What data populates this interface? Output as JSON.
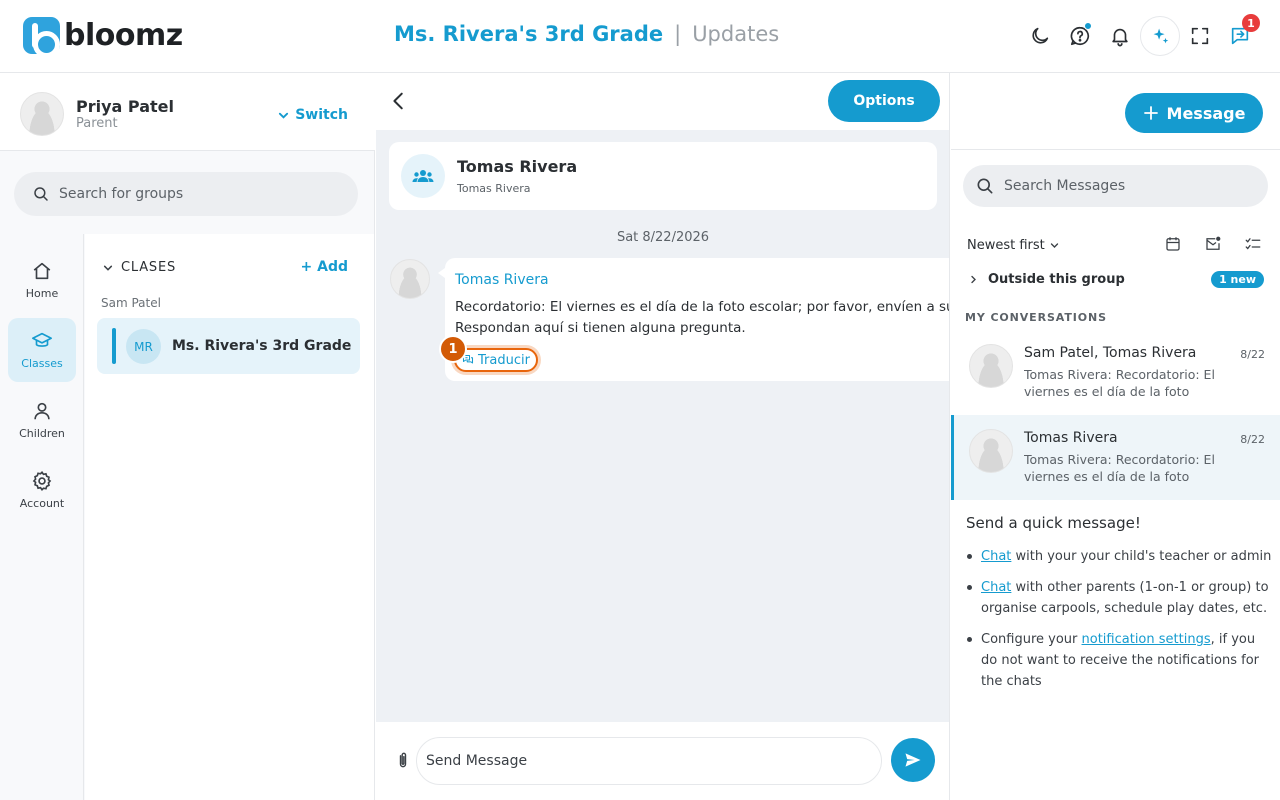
{
  "brand": {
    "name": "bloomz"
  },
  "header": {
    "class_name": "Ms. Rivera's 3rd Grade",
    "separator": "|",
    "page": "Updates",
    "chat_badge": "1"
  },
  "profile": {
    "name": "Priya Patel",
    "role": "Parent",
    "switch_label": "Switch"
  },
  "groups_search": {
    "placeholder": "Search for groups"
  },
  "nav": {
    "home": "Home",
    "classes": "Classes",
    "children": "Children",
    "account": "Account"
  },
  "classes_panel": {
    "header": "CLASES",
    "add_label": "Add",
    "owner": "Sam Patel",
    "class_initials": "MR",
    "class_name": "Ms. Rivera's 3rd Grade"
  },
  "chat": {
    "options_label": "Options",
    "contact_name": "Tomas Rivera",
    "contact_sub": "Tomas Rivera",
    "date": "Sat 8/22/2026",
    "message": {
      "sender": "Tomas Rivera",
      "line1": "Recordatorio: El viernes es el día de la foto escolar; por favor, envíen a su h",
      "line2": "Respondan aquí si tienen alguna pregunta.",
      "translate_label": "Traducir"
    },
    "step_badge": "1",
    "input_placeholder": "Send Message"
  },
  "sidebar_right": {
    "new_message_label": "Message",
    "search_placeholder": "Search Messages",
    "sort_label": "Newest first",
    "outside_label": "Outside this group",
    "new_badge": "1 new",
    "section_title": "MY CONVERSATIONS",
    "conversations": [
      {
        "name": "Sam Patel, Tomas Rivera",
        "date": "8/22",
        "preview": "Tomas Rivera: Recordatorio: El viernes es el día de la foto escol..."
      },
      {
        "name": "Tomas Rivera",
        "date": "8/22",
        "preview": "Tomas Rivera: Recordatorio: El viernes es el día de la foto escol..."
      }
    ],
    "quick": {
      "title": "Send a quick message!",
      "item1_link": "Chat",
      "item1_text": " with your your child's teacher or admin",
      "item2_link": "Chat",
      "item2_text": " with other parents (1-on-1 or group) to organise carpools, schedule play dates, etc.",
      "item3_pre": "Configure your ",
      "item3_link": "notification settings",
      "item3_text": ", if you do not want to receive the notifications for the chats"
    }
  },
  "colors": {
    "accent": "#159bcf",
    "highlight": "#e8650c",
    "alert": "#e83c3c"
  }
}
